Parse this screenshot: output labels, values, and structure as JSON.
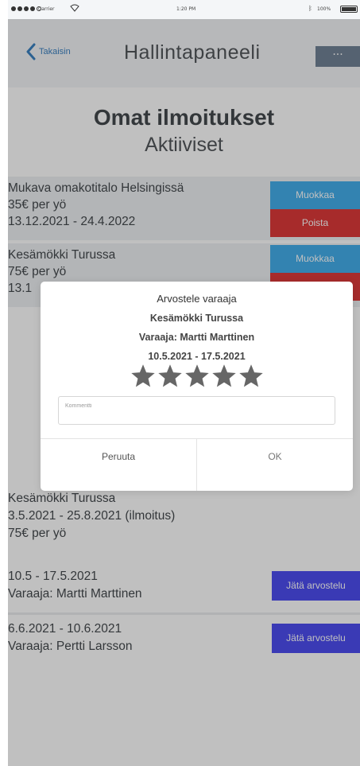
{
  "status_bar": {
    "carrier": "Carrier",
    "time": "1:20 PM",
    "battery": "100%",
    "icons": [
      "signal-dots-icon",
      "wifi-icon",
      "bluetooth-icon",
      "battery-icon"
    ]
  },
  "header": {
    "back_label": "Takaisin",
    "title": "Hallintapaneeli",
    "more_label": "···"
  },
  "page": {
    "title": "Omat ilmoitukset",
    "subtitle": "Aktiiviset"
  },
  "listings": [
    {
      "title": "Mukava omakotitalo Helsingissä",
      "price": "35€ per yö",
      "dates": "13.12.2021 - 24.4.2022",
      "edit_label": "Muokkaa",
      "delete_label": "Poista"
    },
    {
      "title": "Kesämökki Turussa",
      "price": "75€ per yö",
      "dates": "13.1",
      "edit_label": "Muokkaa"
    }
  ],
  "booking": {
    "title": "Kesämökki Turussa",
    "period": "3.5.2021 - 25.8.2021 (ilmoitus)",
    "price": "75€ per yö",
    "rows": [
      {
        "dates": "10.5 - 17.5.2021",
        "booker": "Varaaja: Martti Marttinen",
        "review_label": "Jätä arvostelu"
      },
      {
        "dates": "6.6.2021 - 10.6.2021",
        "booker": "Varaaja: Pertti Larsson",
        "review_label": "Jätä arvostelu"
      }
    ]
  },
  "dialog": {
    "title": "Arvostele varaaja",
    "listing": "Kesämökki Turussa",
    "booker": "Varaaja: Martti Marttinen",
    "dates": "10.5.2021 - 17.5.2021",
    "rating": 5,
    "rating_max": 5,
    "comment_placeholder": "Kommentti",
    "comment_value": "",
    "cancel_label": "Peruuta",
    "ok_label": "OK"
  },
  "colors": {
    "accent_blue": "#2aa3e8",
    "danger_red": "#d91e1e",
    "review_blue": "#3535ee",
    "back_link": "#1f6fb8",
    "more_button": "#5d7187",
    "star": "#666666"
  }
}
